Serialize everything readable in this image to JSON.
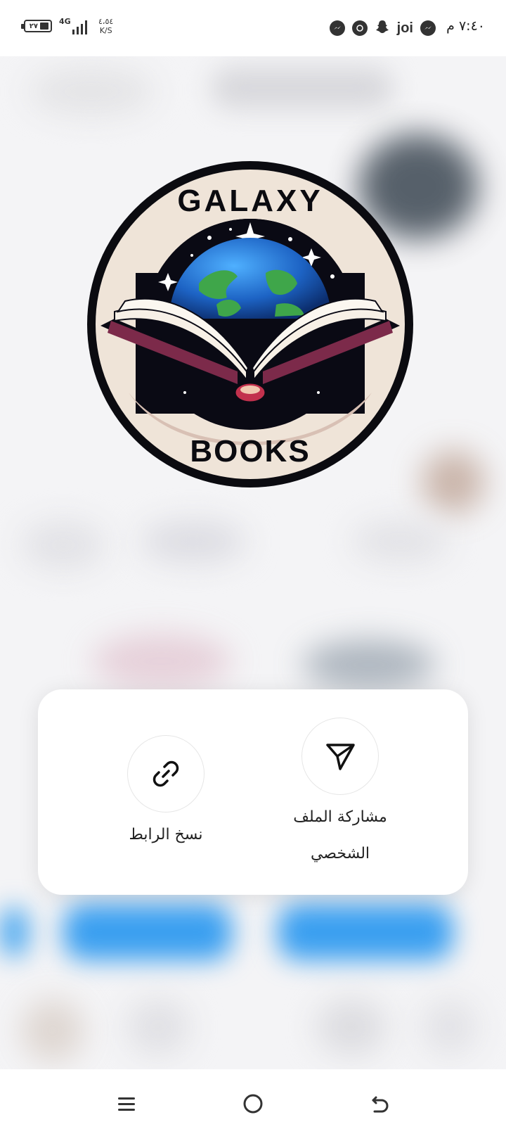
{
  "status_bar": {
    "time": "٧:٤٠ م",
    "speed_value": "٤،٥٤",
    "speed_unit": "K/S",
    "network": "4G",
    "battery": "٢٧",
    "app_badge": "joi"
  },
  "share_sheet": {
    "actions": [
      {
        "label_line1": "مشاركة الملف",
        "label_line2": "الشخصي",
        "icon": "send-icon"
      },
      {
        "label": "نسخ الرابط",
        "icon": "link-icon"
      }
    ]
  },
  "logo": {
    "top_text": "GALAXY",
    "bottom_text": "BOOKS"
  },
  "nav": {
    "icons": [
      "menu-icon",
      "home-icon",
      "back-icon"
    ]
  },
  "colors": {
    "card_bg": "#ffffff",
    "accent_blue": "#2f9cf2",
    "text": "#222222"
  }
}
